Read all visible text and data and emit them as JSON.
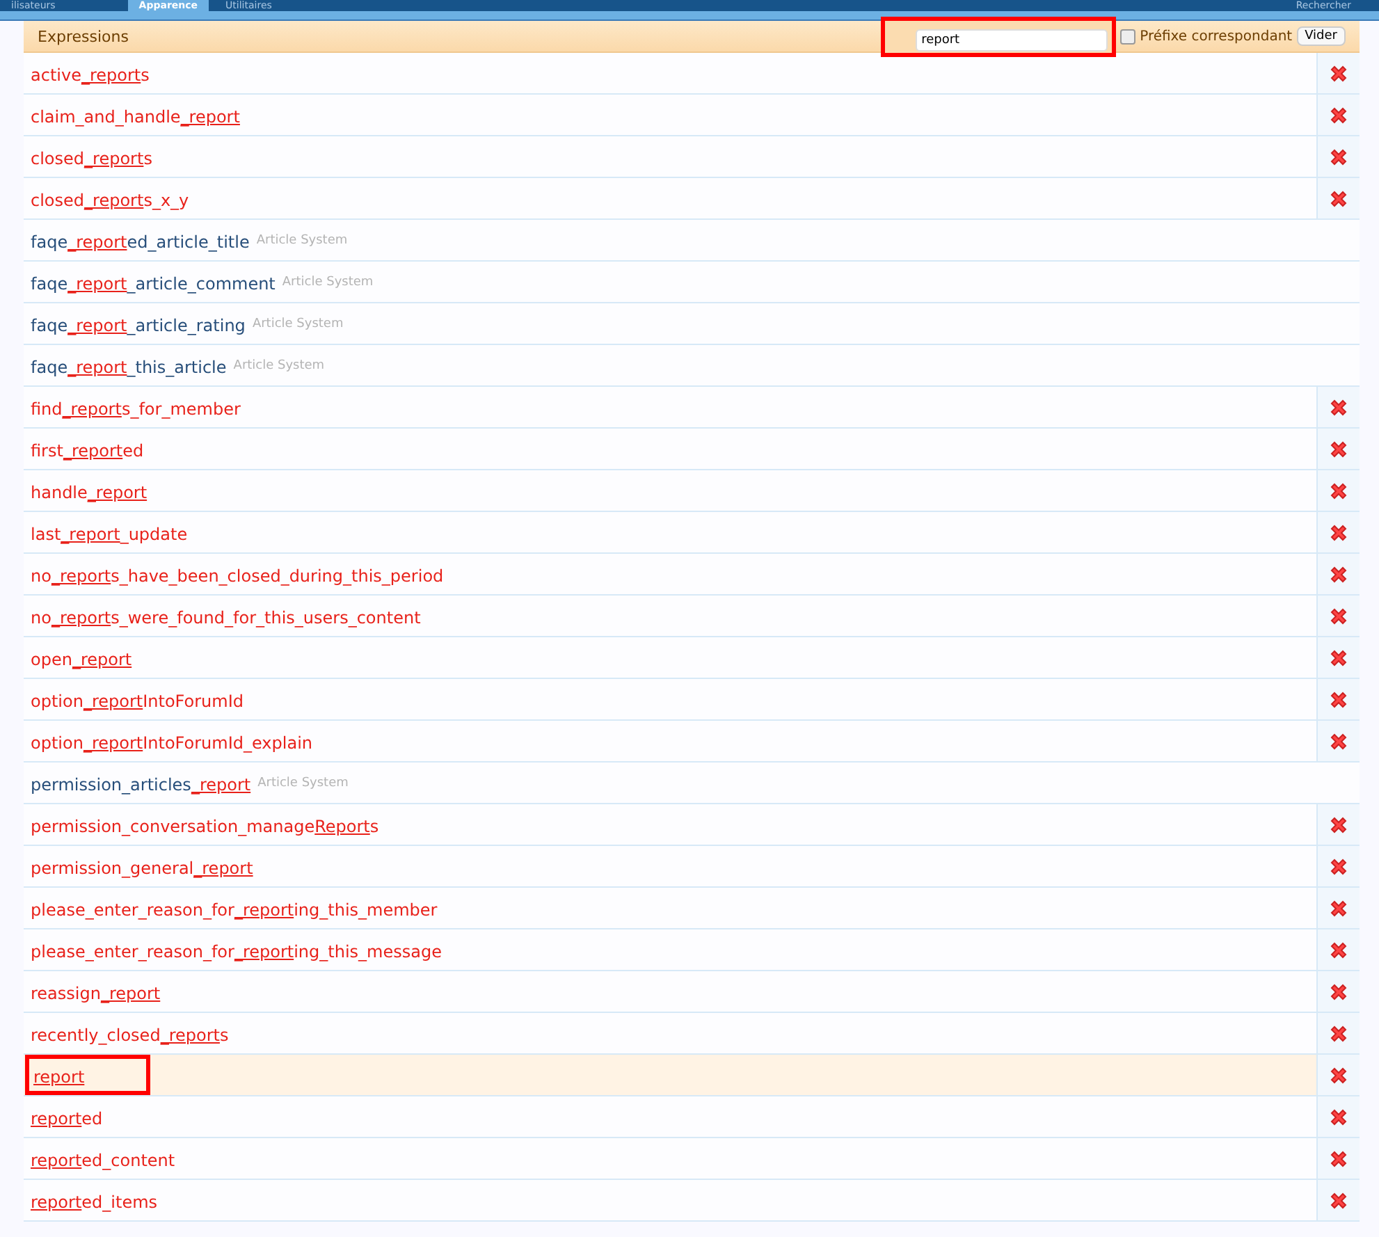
{
  "nav": {
    "tabs": [
      {
        "label": "ilisateurs",
        "selected": false
      },
      {
        "label": "Apparence",
        "selected": true
      },
      {
        "label": "Utilitaires",
        "selected": false
      }
    ],
    "right_link": "Rechercher"
  },
  "header": {
    "title": "Expressions",
    "search": {
      "value": "report"
    },
    "prefix_match": {
      "label": "Préfixe correspondant",
      "checked": false
    },
    "clear_button": "Vider"
  },
  "rows": [
    {
      "kind": "custom",
      "before": "active",
      "match": "_report",
      "after": "s",
      "selected": false
    },
    {
      "kind": "custom",
      "before": "claim_and_handle",
      "match": "_report",
      "after": "",
      "selected": false
    },
    {
      "kind": "custom",
      "before": "closed",
      "match": "_report",
      "after": "s",
      "selected": false
    },
    {
      "kind": "custom",
      "before": "closed",
      "match": "_report",
      "after": "s_x_y",
      "selected": false
    },
    {
      "kind": "addon",
      "before": "faqe",
      "match": "_report",
      "after": "ed_article_title",
      "addon": "Article System",
      "selected": false
    },
    {
      "kind": "addon",
      "before": "faqe",
      "match": "_report",
      "after": "_article_comment",
      "addon": "Article System",
      "selected": false
    },
    {
      "kind": "addon",
      "before": "faqe",
      "match": "_report",
      "after": "_article_rating",
      "addon": "Article System",
      "selected": false
    },
    {
      "kind": "addon",
      "before": "faqe",
      "match": "_report",
      "after": "_this_article",
      "addon": "Article System",
      "selected": false
    },
    {
      "kind": "custom",
      "before": "find",
      "match": "_report",
      "after": "s_for_member",
      "selected": false
    },
    {
      "kind": "custom",
      "before": "first",
      "match": "_report",
      "after": "ed",
      "selected": false
    },
    {
      "kind": "custom",
      "before": "handle",
      "match": "_report",
      "after": "",
      "selected": false
    },
    {
      "kind": "custom",
      "before": "last",
      "match": "_report",
      "after": "_update",
      "selected": false
    },
    {
      "kind": "custom",
      "before": "no",
      "match": "_report",
      "after": "s_have_been_closed_during_this_period",
      "selected": false
    },
    {
      "kind": "custom",
      "before": "no",
      "match": "_report",
      "after": "s_were_found_for_this_users_content",
      "selected": false
    },
    {
      "kind": "custom",
      "before": "open",
      "match": "_report",
      "after": "",
      "selected": false
    },
    {
      "kind": "custom",
      "before": "option",
      "match": "_report",
      "after": "IntoForumId",
      "selected": false
    },
    {
      "kind": "custom",
      "before": "option",
      "match": "_report",
      "after": "IntoForumId_explain",
      "selected": false
    },
    {
      "kind": "addon",
      "before": "permission_articles",
      "match": "_report",
      "after": "",
      "addon": "Article System",
      "selected": false
    },
    {
      "kind": "custom",
      "before": "permission_conversation_manage",
      "match": "Report",
      "after": "s",
      "selected": false
    },
    {
      "kind": "custom",
      "before": "permission_general",
      "match": "_report",
      "after": "",
      "selected": false
    },
    {
      "kind": "custom",
      "before": "please_enter_reason_for",
      "match": "_report",
      "after": "ing_this_member",
      "selected": false
    },
    {
      "kind": "custom",
      "before": "please_enter_reason_for",
      "match": "_report",
      "after": "ing_this_message",
      "selected": false
    },
    {
      "kind": "custom",
      "before": "reassign",
      "match": "_report",
      "after": "",
      "selected": false
    },
    {
      "kind": "custom",
      "before": "recently_closed",
      "match": "_report",
      "after": "s",
      "selected": false
    },
    {
      "kind": "custom",
      "before": "",
      "match": "report",
      "after": "",
      "selected": true
    },
    {
      "kind": "custom",
      "before": "",
      "match": "report",
      "after": "ed",
      "selected": false
    },
    {
      "kind": "custom",
      "before": "",
      "match": "report",
      "after": "ed_content",
      "selected": false
    },
    {
      "kind": "custom",
      "before": "",
      "match": "report",
      "after": "ed_items",
      "selected": false
    }
  ]
}
